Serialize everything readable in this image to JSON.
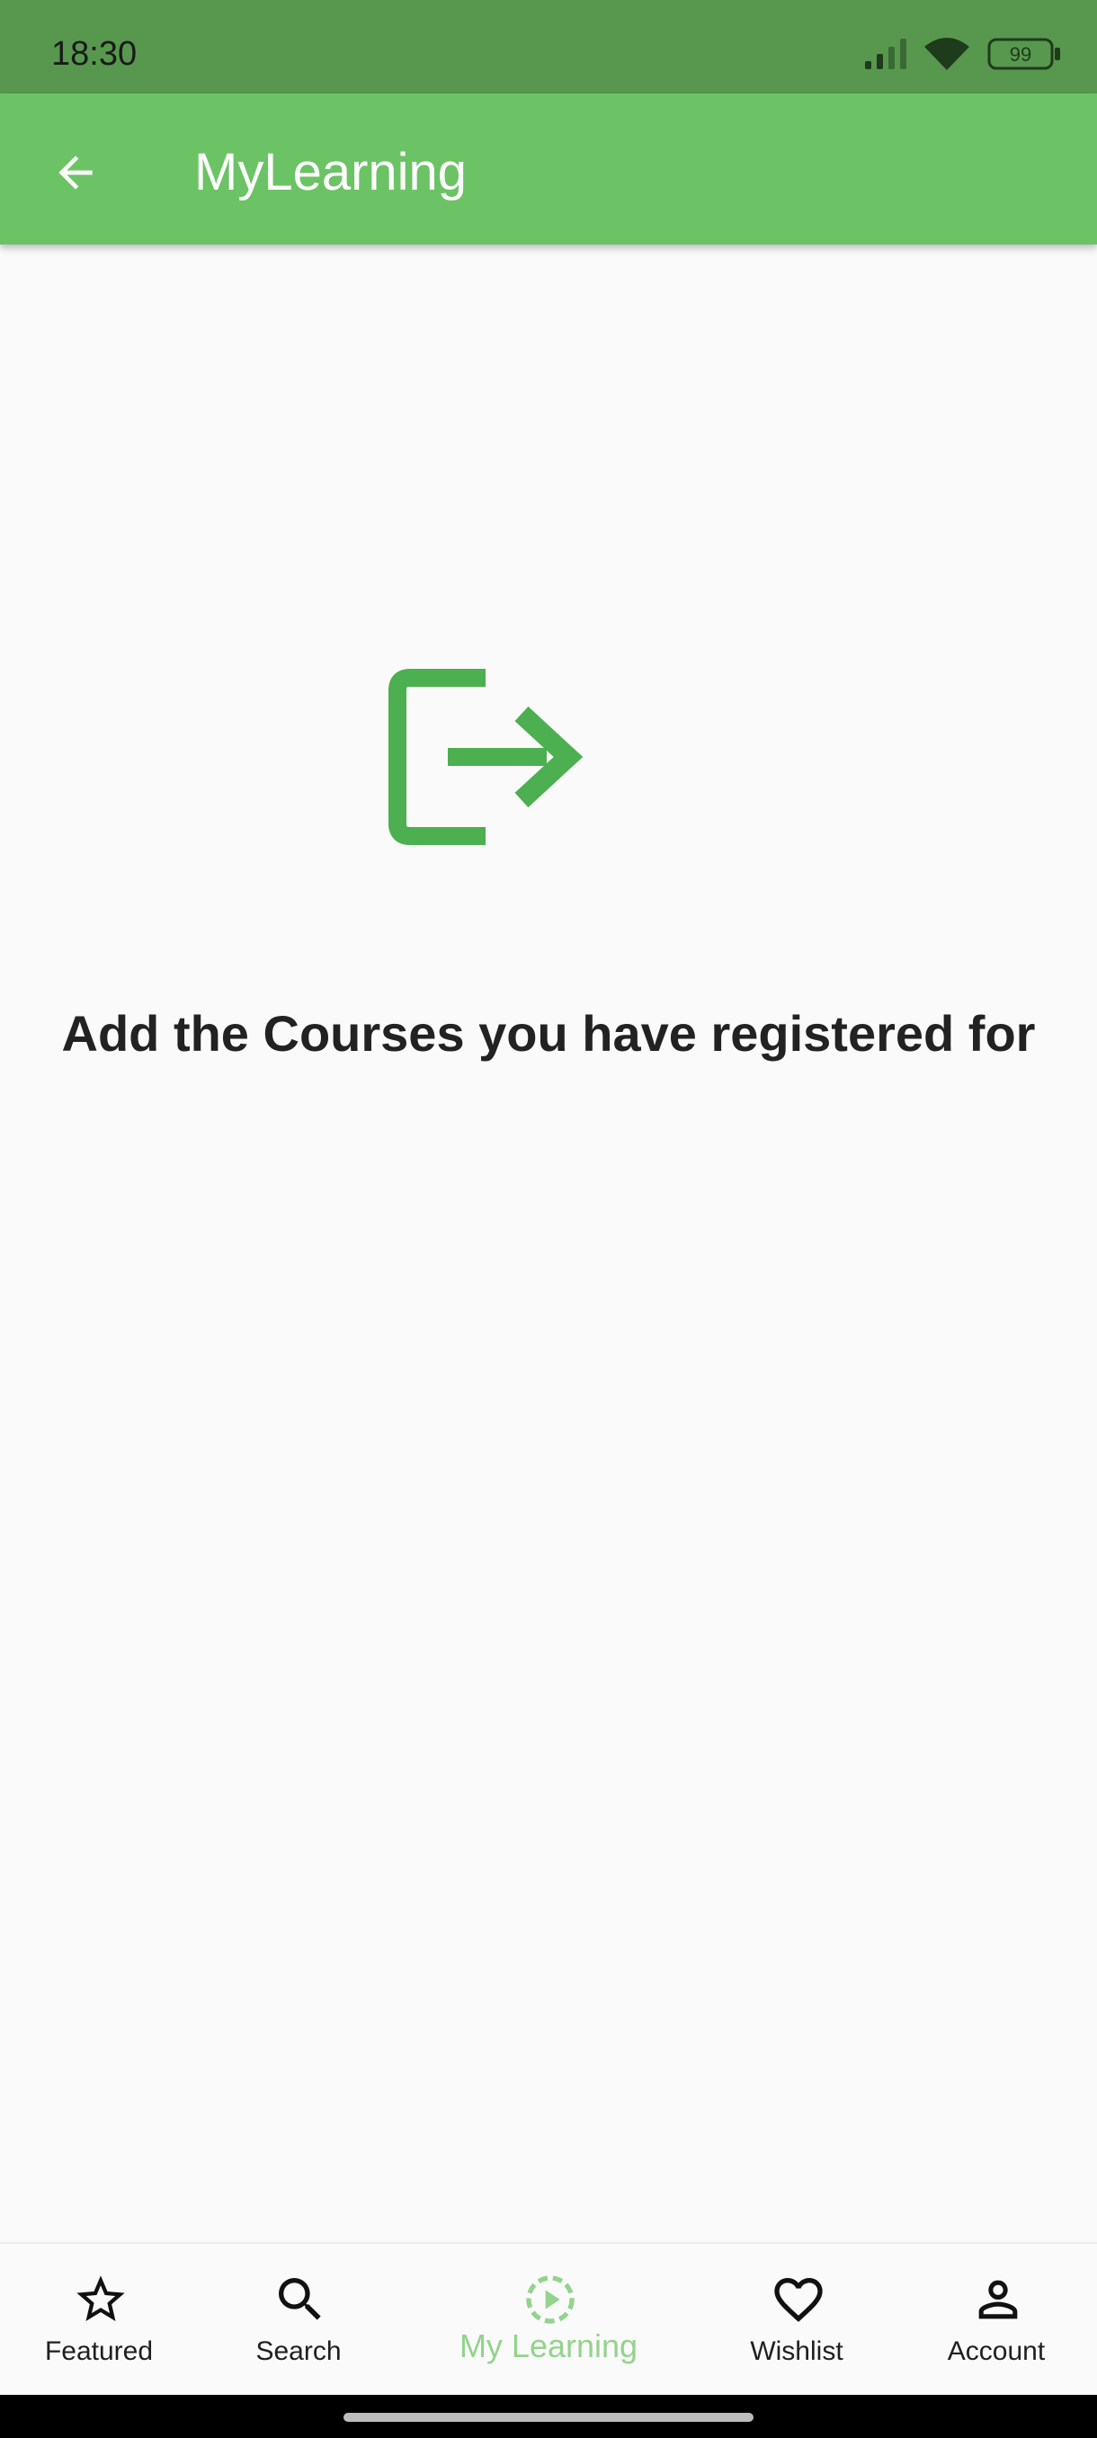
{
  "status_bar": {
    "time": "18:30",
    "battery_level": "99"
  },
  "app_bar": {
    "title": "MyLearning"
  },
  "empty_state": {
    "icon": "login-icon",
    "message": "Add the Courses you have registered for"
  },
  "bottom_nav": {
    "items": [
      {
        "label": "Featured",
        "icon": "star-icon",
        "active": false
      },
      {
        "label": "Search",
        "icon": "search-icon",
        "active": false
      },
      {
        "label": "My Learning",
        "icon": "play-circle-icon",
        "active": true
      },
      {
        "label": "Wishlist",
        "icon": "heart-icon",
        "active": false
      },
      {
        "label": "Account",
        "icon": "person-icon",
        "active": false
      }
    ]
  },
  "colors": {
    "status_bar": "#57984e",
    "app_bar": "#6cc365",
    "accent_icon": "#4caf50",
    "active_tab": "#93d38c",
    "background": "#fafafa",
    "text": "#222222"
  }
}
